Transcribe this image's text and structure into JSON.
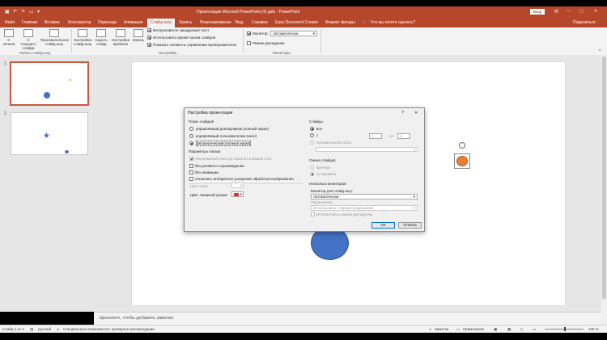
{
  "app": {
    "title": "Презентация Microsoft PowerPoint (4).pptx - PowerPoint",
    "login_label": "Вход",
    "share_label": "Поделиться",
    "tell_me": "Что вы хотите сделать?",
    "accent_color": "#b7472a"
  },
  "tabs": [
    {
      "label": "Файл"
    },
    {
      "label": "Главная"
    },
    {
      "label": "Вставка"
    },
    {
      "label": "Конструктор"
    },
    {
      "label": "Переходы"
    },
    {
      "label": "Анимация"
    },
    {
      "label": "Слайд-шоу"
    },
    {
      "label": "Запись"
    },
    {
      "label": "Рецензирование"
    },
    {
      "label": "Вид"
    },
    {
      "label": "Справка"
    },
    {
      "label": "Easy Document Creator"
    },
    {
      "label": "Формат фигуры"
    }
  ],
  "ribbon": {
    "from_start": "С начала",
    "from_current": "С текущего слайда",
    "online_present": "Произволольное слайд-шоу",
    "group_start": "Начать слайд-шоу",
    "setup_show": "Настройка слайд-шоу",
    "hide_slide": "Скрыть слайд",
    "rehearse": "Настройка времени",
    "record": "Запись",
    "cb_narration": "Воспроизвести закадровый текст",
    "cb_timings": "Использовать время показа слайдов",
    "cb_media": "Показать элементы управления проигрывателем",
    "group_setup": "Настройка",
    "monitor_label": "Монитор:",
    "monitor_value": "Автоматически",
    "presenter_view": "Режим докладчика",
    "group_monitors": "Мониторы"
  },
  "thumbnails": [
    {
      "number": "1"
    },
    {
      "number": "2"
    }
  ],
  "notes_placeholder": "Щелкните, чтобы добавить заметки",
  "status": {
    "slide": "Слайд 1 из 2",
    "language": "русский",
    "accessibility": "Специальные возможности: проверьте рекомендации",
    "notes": "Заметки",
    "comments": "Примечания",
    "zoom": "105 %"
  },
  "dialog": {
    "title": "Настройка презентации",
    "help": "?",
    "close": "✕",
    "show_type_label": "Показ слайдов",
    "show_types": [
      "управляемый докладчиком (полный экран)",
      "управляемый пользователем (окно)",
      "автоматический (полный экран)"
    ],
    "show_options_label": "Параметры показа",
    "options": [
      "непрерывный цикл до нажатия клавиши ESC",
      "без речевого сопровождения",
      "без анимации",
      "отключить аппаратное ускорение обработки изображения"
    ],
    "pen_color_label": "Цвет пера:",
    "laser_color_label": "Цвет лазерной указки:",
    "slides_label": "Слайды",
    "slides_all": "все",
    "slides_from": "с",
    "slides_from_value": "1",
    "slides_to": "по:",
    "slides_to_value": "2",
    "custom_show": "произвольный показ:",
    "advance_label": "Смена слайдов",
    "advance_manual": "вручную",
    "advance_timing": "по времени",
    "multi_monitor_label": "Несколько мониторов",
    "monitor_for_show": "Монитор для слайд-шоу:",
    "monitor_value": "Автоматически",
    "resolution_label": "Разрешение:",
    "resolution_value": "Использовать текущее разрешение",
    "use_presenter": "Использовать режим докладчика",
    "ok": "ОК",
    "cancel": "Отмена"
  },
  "colors": {
    "circle": "#4472c4",
    "star": "#4472c4",
    "selected_shape": "#ed7d31",
    "small_dot": "#c9a227"
  }
}
